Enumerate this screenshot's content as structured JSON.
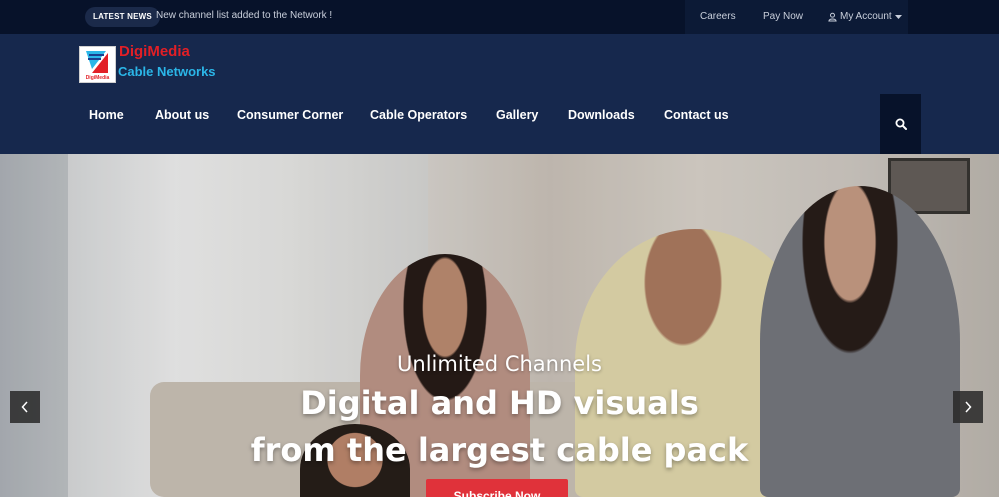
{
  "topbar": {
    "badge": "LATEST NEWS",
    "ticker": "New channel list added to the Network !",
    "links": {
      "careers": "Careers",
      "pay_now": "Pay Now",
      "my_account": "My Account"
    }
  },
  "header": {
    "logo": {
      "line1": "DigiMedia",
      "line2": "Cable Networks",
      "mark_text": "DigiMedia"
    },
    "nav": [
      "Home",
      "About us",
      "Consumer Corner",
      "Cable Operators",
      "Gallery",
      "Downloads",
      "Contact us"
    ]
  },
  "hero": {
    "subtitle": "Unlimited Channels",
    "title_line1": "Digital and HD visuals",
    "title_line2": "from the largest cable pack",
    "cta": "Subscribe Now"
  },
  "colors": {
    "topbar_bg": "#07122a",
    "header_bg": "#16284d",
    "cta_bg": "#e0323a",
    "logo_red": "#e21f26",
    "logo_blue": "#2bb6e8"
  },
  "icons": {
    "account": "user-icon",
    "caret": "caret-down-icon",
    "search": "search-icon",
    "prev": "chevron-left-icon",
    "next": "chevron-right-icon"
  }
}
